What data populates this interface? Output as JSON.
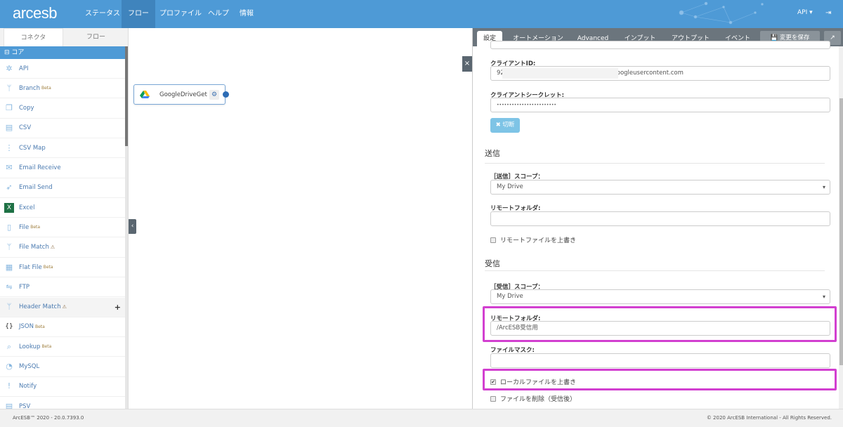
{
  "header": {
    "logo": "arcesb",
    "nav": [
      "ステータス",
      "フロー",
      "プロファイル",
      "ヘルプ",
      "情報"
    ],
    "active_nav": "フロー",
    "user_menu": "API ▾",
    "logout_icon": "sign-out-icon"
  },
  "sidebar": {
    "tabs": [
      "コネクタ",
      "フロー"
    ],
    "group": "⊟ コア",
    "items": [
      {
        "label": "API",
        "badge": "",
        "icon": "api-icon",
        "glyph": "✲"
      },
      {
        "label": "Branch",
        "badge": "Beta",
        "icon": "branch-icon",
        "glyph": "ᛘ"
      },
      {
        "label": "Copy",
        "badge": "",
        "icon": "copy-icon",
        "glyph": "❐"
      },
      {
        "label": "CSV",
        "badge": "",
        "icon": "csv-icon",
        "glyph": "▤"
      },
      {
        "label": "CSV Map",
        "badge": "",
        "icon": "csv-map-icon",
        "glyph": "⋮"
      },
      {
        "label": "Email Receive",
        "badge": "",
        "icon": "email-receive-icon",
        "glyph": "✉"
      },
      {
        "label": "Email Send",
        "badge": "",
        "icon": "email-send-icon",
        "glyph": "➶"
      },
      {
        "label": "Excel",
        "badge": "",
        "icon": "excel-icon",
        "glyph": "X"
      },
      {
        "label": "File",
        "badge": "Beta",
        "icon": "file-icon",
        "glyph": "▯"
      },
      {
        "label": "File Match",
        "badge": "⚠",
        "icon": "file-match-icon",
        "glyph": "ᛘ"
      },
      {
        "label": "Flat File",
        "badge": "Beta",
        "icon": "flat-file-icon",
        "glyph": "▦"
      },
      {
        "label": "FTP",
        "badge": "",
        "icon": "ftp-icon",
        "glyph": "⇋"
      },
      {
        "label": "Header Match",
        "badge": "⚠",
        "icon": "header-match-icon",
        "glyph": "ᛘ"
      },
      {
        "label": "JSON",
        "badge": "Beta",
        "icon": "json-icon",
        "glyph": "{}"
      },
      {
        "label": "Lookup",
        "badge": "Beta",
        "icon": "lookup-icon",
        "glyph": "⌕"
      },
      {
        "label": "MySQL",
        "badge": "",
        "icon": "mysql-icon",
        "glyph": "◔"
      },
      {
        "label": "Notify",
        "badge": "",
        "icon": "notify-icon",
        "glyph": "!"
      },
      {
        "label": "PSV",
        "badge": "",
        "icon": "psv-icon",
        "glyph": "▤"
      }
    ],
    "add": "+"
  },
  "canvas": {
    "node_label": "GoogleDriveGet"
  },
  "panel": {
    "tabs": [
      "設定",
      "オートメーション",
      "Advanced",
      "インプット",
      "アウトプット",
      "イベント"
    ],
    "save": "💾 変更を保存",
    "client_id_label": "クライアントID:",
    "client_id": "927                                            s.apps.googleusercontent.com",
    "secret_label": "クライアントシークレット:",
    "secret": "••••••••••••••••••••••••",
    "disconnect": "✖ 切断",
    "send_heading": "送信",
    "send_scope_label": "［送信］スコープ：",
    "send_scope": "My Drive",
    "send_folder_label": "リモートフォルダ:",
    "send_folder": "",
    "send_overwrite": "リモートファイルを上書き",
    "recv_heading": "受信",
    "recv_scope_label": "［受信］スコープ：",
    "recv_scope": "My Drive",
    "recv_folder_label": "リモートフォルダ:",
    "recv_folder": "/ArcESB受信用",
    "mask_label": "ファイルマスク:",
    "mask": "",
    "local_overwrite": "ローカルファイルを上書き",
    "local_overwrite_checked": true,
    "delete_after": "ファイルを削除（受信後）",
    "delete_after_checked": false
  },
  "footer": {
    "version": "ArcESB™ 2020 - 20.0.7393.0",
    "copyright": "© 2020 ArcESB International - All Rights Reserved."
  },
  "colors": {
    "primary": "#4e9ad6",
    "highlight": "#d23fd0",
    "tabbar": "#6b757d"
  }
}
